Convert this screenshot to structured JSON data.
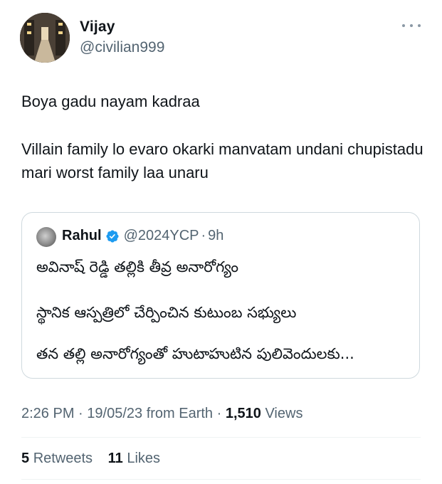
{
  "author": {
    "name": "Vijay",
    "handle": "@civilian999"
  },
  "tweet": {
    "lines": [
      "Boya gadu nayam kadraa",
      "Villain family lo evaro okarki manvatam undani chupistadu mari worst family laa unaru"
    ]
  },
  "quoted_tweet": {
    "name": "Rahul",
    "handle": "@2024YCP",
    "separator": "·",
    "time": "9h",
    "lines": [
      "అవినాష్ రెడ్డి తల్లికి తీవ్ర అనారోగ్యం",
      "స్థానిక ఆస్పత్రిలో చేర్పించిన కుటుంబ సభ్యులు",
      "తన తల్లి అనారోగ్యంతో హుటాహుటిన పులివెందులకు..."
    ]
  },
  "meta": {
    "time": "2:26 PM",
    "date": "19/05/23",
    "source": "from Earth",
    "views_count": "1,510",
    "views_label": "Views"
  },
  "stats": {
    "retweets_count": "5",
    "retweets_label": "Retweets",
    "likes_count": "11",
    "likes_label": "Likes"
  },
  "colors": {
    "text": "#0f1419",
    "secondary": "#536471",
    "border": "#cfd9de",
    "verified": "#1d9bf0"
  },
  "icons": [
    "more-icon",
    "verified-badge-icon"
  ]
}
